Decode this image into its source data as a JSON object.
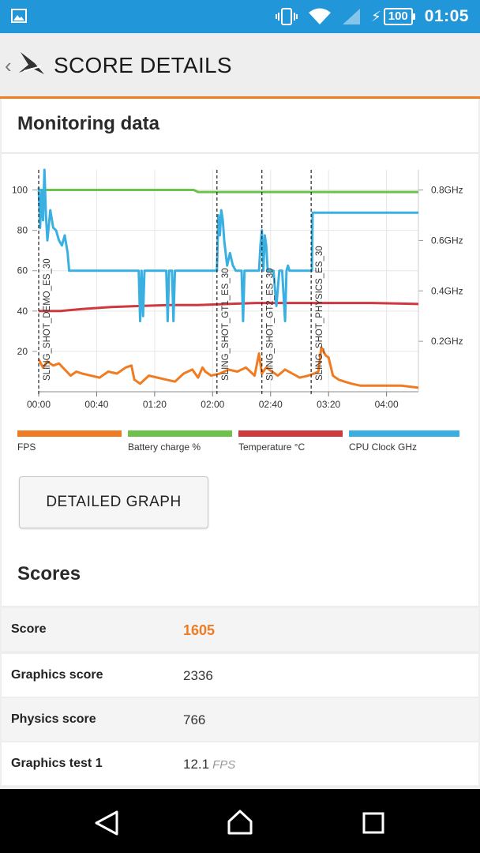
{
  "status_bar": {
    "battery": "100",
    "time": "01:05"
  },
  "action_bar": {
    "title": "SCORE DETAILS"
  },
  "monitoring": {
    "heading": "Monitoring data",
    "detailed_graph_label": "DETAILED GRAPH"
  },
  "chart_data": {
    "type": "line",
    "x_ticks": [
      "00:00",
      "00:40",
      "01:20",
      "02:00",
      "02:40",
      "03:20",
      "04:00"
    ],
    "y_left_ticks": [
      "100",
      "80",
      "60",
      "40",
      "20"
    ],
    "y_right_ticks": [
      "0.8GHz",
      "0.6GHz",
      "0.4GHz",
      "0.2GHz"
    ],
    "ylim_left": [
      0,
      110
    ],
    "ylim_right": [
      0,
      0.88
    ],
    "test_markers": [
      {
        "label": "SLING_SHOT_DEMO_ES_30",
        "x": "00:00"
      },
      {
        "label": "SLING_SHOT_GT1_ES_30",
        "x": "02:03"
      },
      {
        "label": "SLING_SHOT_GT2_ES_30",
        "x": "02:34"
      },
      {
        "label": "SLING_SHOT_PHYSICS_ES_30",
        "x": "03:08"
      }
    ],
    "legend": [
      "FPS",
      "Battery charge %",
      "Temperature °C",
      "CPU Clock GHz"
    ],
    "colors": {
      "fps": "#ef7b22",
      "battery": "#6cc24a",
      "temperature": "#d0383f",
      "cpu": "#3ab0e2"
    },
    "series": [
      {
        "name": "Battery charge %",
        "axis": "left",
        "x": [
          0,
          30,
          60,
          90,
          107,
          110,
          140,
          180,
          210,
          240,
          262
        ],
        "y": [
          100,
          100,
          100,
          100,
          100,
          99,
          99,
          99,
          99,
          99,
          99
        ]
      },
      {
        "name": "Temperature °C",
        "axis": "left",
        "x": [
          0,
          15,
          30,
          50,
          70,
          90,
          110,
          130,
          150,
          170,
          200,
          230,
          262
        ],
        "y": [
          40,
          40,
          41,
          42,
          42.5,
          43,
          43,
          43.5,
          44,
          44,
          44,
          44,
          43.5
        ]
      },
      {
        "name": "FPS",
        "axis": "left",
        "x": [
          0,
          3,
          6,
          10,
          14,
          18,
          22,
          26,
          30,
          36,
          42,
          48,
          54,
          60,
          64,
          66,
          70,
          76,
          82,
          88,
          94,
          100,
          106,
          110,
          113,
          115,
          119,
          125,
          131,
          137,
          143,
          149,
          152,
          154,
          157,
          161,
          165,
          170,
          175,
          180,
          186,
          190,
          193,
          195,
          198,
          200,
          203,
          207,
          211,
          216,
          222,
          230,
          240,
          250,
          262
        ],
        "y": [
          16,
          12,
          15,
          13,
          14,
          11,
          8,
          10,
          9,
          8,
          7,
          10,
          9,
          12,
          13,
          6,
          4,
          8,
          7,
          6,
          5,
          9,
          11,
          7,
          12,
          10,
          8,
          9,
          11,
          10,
          12,
          8,
          19,
          9,
          12,
          10,
          8,
          11,
          9,
          7,
          8,
          9,
          10,
          22,
          18,
          17,
          8,
          6,
          5,
          4,
          3,
          3,
          3,
          3,
          2
        ]
      },
      {
        "name": "CPU Clock GHz",
        "axis": "right",
        "x": [
          0,
          1,
          2,
          3,
          4,
          5,
          6,
          7,
          8,
          10,
          12,
          14,
          16,
          18,
          20,
          21,
          22,
          50,
          69,
          70,
          71,
          72,
          73,
          74,
          75,
          76,
          77,
          78,
          88,
          89,
          90,
          91,
          92,
          93,
          94,
          95,
          110,
          123,
          124,
          125,
          126,
          127,
          128,
          130,
          132,
          134,
          136,
          138,
          140,
          141,
          142,
          143,
          144,
          152,
          153,
          154,
          155,
          156,
          157,
          158,
          160,
          162,
          164,
          166,
          168,
          170,
          171,
          172,
          173,
          174,
          175,
          176,
          177,
          178,
          180,
          185,
          187,
          188,
          188.5,
          189,
          200,
          222,
          223,
          224,
          240,
          262
        ],
        "y": [
          0.81,
          0.65,
          0.8,
          0.68,
          0.88,
          0.7,
          0.6,
          0.66,
          0.72,
          0.65,
          0.64,
          0.6,
          0.58,
          0.62,
          0.55,
          0.48,
          0.48,
          0.48,
          0.48,
          0.28,
          0.48,
          0.3,
          0.48,
          0.48,
          0.48,
          0.48,
          0.48,
          0.48,
          0.48,
          0.28,
          0.48,
          0.48,
          0.48,
          0.28,
          0.48,
          0.48,
          0.48,
          0.48,
          0.7,
          0.62,
          0.72,
          0.68,
          0.6,
          0.5,
          0.55,
          0.5,
          0.48,
          0.48,
          0.48,
          0.28,
          0.48,
          0.48,
          0.48,
          0.48,
          0.58,
          0.64,
          0.48,
          0.62,
          0.58,
          0.48,
          0.48,
          0.48,
          0.34,
          0.48,
          0.48,
          0.28,
          0.48,
          0.5,
          0.48,
          0.48,
          0.48,
          0.48,
          0.48,
          0.48,
          0.48,
          0.48,
          0.48,
          0.48,
          0.48,
          0.71,
          0.71,
          0.71,
          0.71,
          0.71,
          0.71,
          0.71
        ]
      }
    ]
  },
  "scores": {
    "heading": "Scores",
    "rows": [
      {
        "label": "Score",
        "value": "1605",
        "unit": ""
      },
      {
        "label": "Graphics score",
        "value": "2336",
        "unit": ""
      },
      {
        "label": "Physics score",
        "value": "766",
        "unit": ""
      },
      {
        "label": "Graphics test 1",
        "value": "12.1",
        "unit": "FPS"
      }
    ]
  }
}
